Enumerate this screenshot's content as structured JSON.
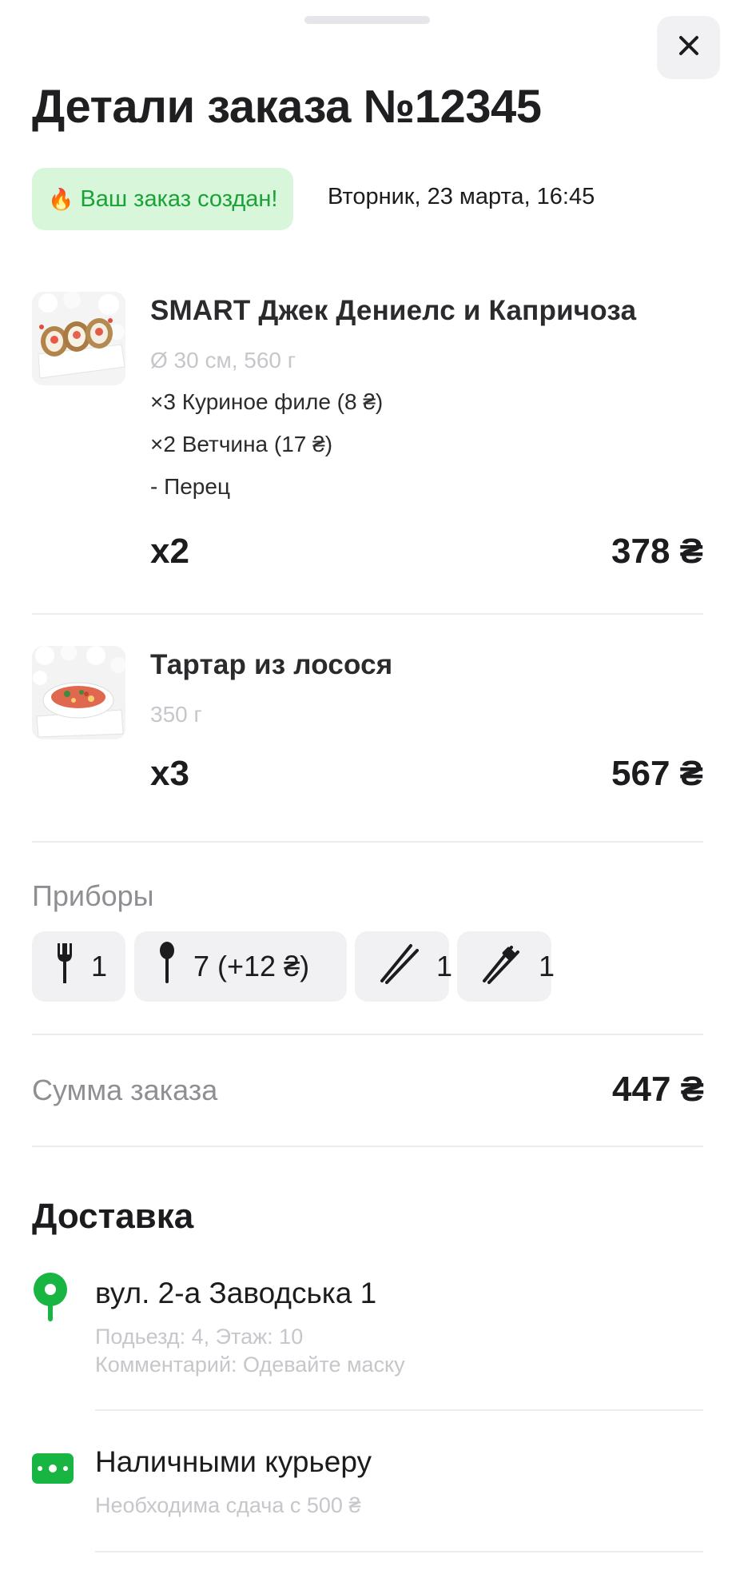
{
  "header": {
    "title": "Детали заказа №12345",
    "close_icon": "close-icon"
  },
  "status": {
    "emoji": "🔥",
    "text": "Ваш заказ создан!",
    "date": "Вторник, 23 марта, 16:45",
    "badge_color": "#d8f6d9",
    "text_color": "#1aa239"
  },
  "items": [
    {
      "name": "SMART Джек Дениелс и Капричоза",
      "spec": "Ø 30 см, 560 г",
      "modifiers": [
        "×3 Куриное филе (8 ₴)",
        "×2 Ветчина (17 ₴)",
        "- Перец"
      ],
      "qty": "x2",
      "price": "378 ₴"
    },
    {
      "name": "Тартар из лосося",
      "spec": "350 г",
      "modifiers": [],
      "qty": "x3",
      "price": "567 ₴"
    }
  ],
  "cutlery": {
    "label": "Приборы",
    "chips": [
      {
        "icon": "fork-icon",
        "value": "1"
      },
      {
        "icon": "spoon-icon",
        "value": "7 (+12 ₴)"
      },
      {
        "icon": "chopsticks-icon",
        "value": "1"
      },
      {
        "icon": "training-chopsticks-icon",
        "value": "1"
      }
    ]
  },
  "summary": {
    "label": "Сумма заказа",
    "total": "447 ₴"
  },
  "delivery": {
    "heading": "Доставка",
    "address": {
      "icon": "location-pin-icon",
      "main": "вул. 2-а Заводська 1",
      "details": "Подьезд: 4, Этаж: 10",
      "comment": "Комментарий: Одевайте маску"
    },
    "payment": {
      "icon": "cash-icon",
      "main": "Наличными курьеру",
      "sub": "Необходима сдача с 500 ₴"
    },
    "accent_color": "#19b542"
  }
}
